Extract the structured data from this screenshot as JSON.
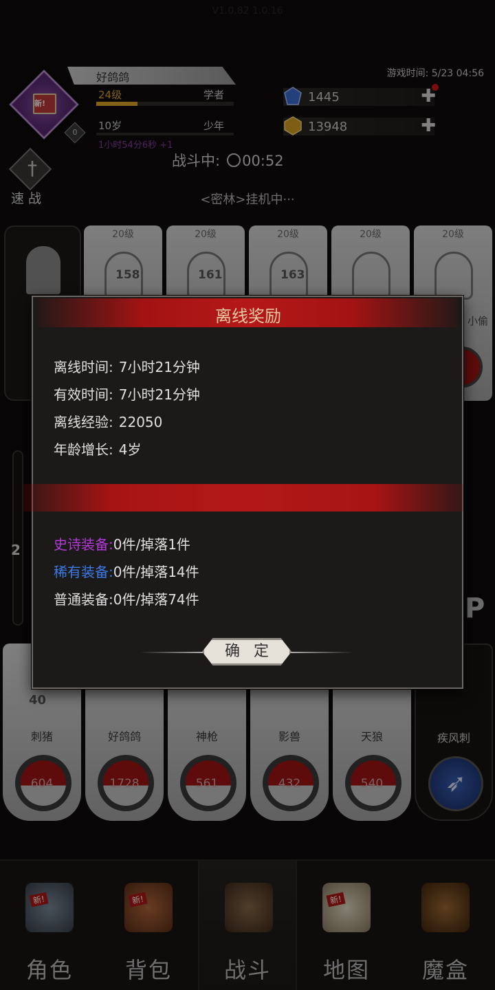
{
  "version_ghost": "V1.0.82 1.0.16",
  "player": {
    "name": "好鸽鸽",
    "level": "24级",
    "class": "学者",
    "level_progress": 0.3,
    "age": "10岁",
    "life_stage": "少年",
    "age_timer": "1小时54分6秒 +1",
    "avatar_new": "新!",
    "avatar_count": "0"
  },
  "game_time": "游戏时间: 5/23 04:56",
  "resources": {
    "gems": "1445",
    "gold": "13948"
  },
  "battle": {
    "status_label": "战斗中:",
    "timer": "00:52",
    "speed_label": "速 战",
    "location": "<密林>挂机中···"
  },
  "heroes": [
    {
      "level": "20级",
      "power": "158"
    },
    {
      "level": "20级",
      "power": "161"
    },
    {
      "level": "20级",
      "power": "163"
    },
    {
      "level": "20级",
      "power": ""
    },
    {
      "level": "20级",
      "power": "",
      "name": "小偷"
    }
  ],
  "gauge_value": "2",
  "skills": [
    {
      "num": "40",
      "name": "刺猪",
      "cd": "604"
    },
    {
      "num": "",
      "name": "好鸽鸽",
      "cd": "1728"
    },
    {
      "num": "",
      "name": "神枪",
      "cd": "561"
    },
    {
      "num": "",
      "name": "影兽",
      "cd": "432"
    },
    {
      "num": "",
      "name": "天狼",
      "cd": "540"
    },
    {
      "num": "",
      "name": "疾风刺",
      "cd": ""
    }
  ],
  "dialog": {
    "title": "离线奖励",
    "offline_time_label": "离线时间:",
    "offline_time": "7小时21分钟",
    "effective_time_label": "有效时间:",
    "effective_time": "7小时21分钟",
    "offline_exp_label": "离线经验:",
    "offline_exp": "22050",
    "age_growth_label": "年龄增长:",
    "age_growth": "4岁",
    "epic_label": "史诗装备:",
    "epic_value": "0件/掉落1件",
    "rare_label": "稀有装备:",
    "rare_value": "0件/掉落14件",
    "common_label": "普通装备:",
    "common_value": "0件/掉落74件",
    "confirm": "确定"
  },
  "nav": [
    {
      "label": "角色",
      "new": "新!"
    },
    {
      "label": "背包",
      "new": "新!"
    },
    {
      "label": "战斗",
      "new": ""
    },
    {
      "label": "地图",
      "new": "新!"
    },
    {
      "label": "魔盒",
      "new": ""
    }
  ],
  "colors": {
    "accent_red": "#b31818",
    "level_gold": "#e3a92a",
    "epic": "#b33ad8",
    "rare": "#3c7ae6"
  }
}
